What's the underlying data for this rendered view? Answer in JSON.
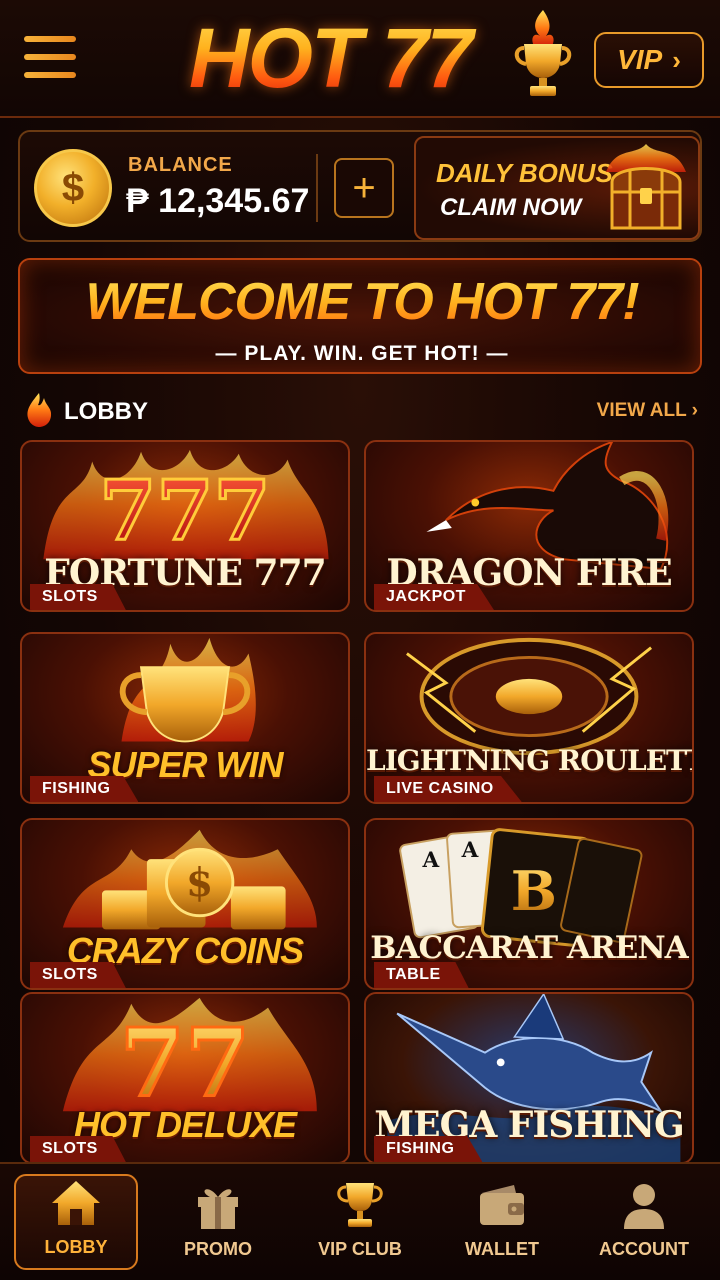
{
  "header": {
    "logo_text": "HOT 77",
    "vip_label": "VIP",
    "vip_chevron": "›"
  },
  "balance": {
    "label": "BALANCE",
    "value": "₱ 12,345.67",
    "coin_symbol": "$",
    "add_symbol": "+"
  },
  "daily_bonus": {
    "line1": "DAILY BONUS",
    "line2": "CLAIM NOW"
  },
  "welcome": {
    "title": "WELCOME TO HOT 77!",
    "subtitle": "— PLAY. WIN. GET HOT! —"
  },
  "lobby": {
    "title": "LOBBY",
    "view_all": "VIEW ALL  ›"
  },
  "games": [
    {
      "name": "FORTUNE 777",
      "category": "SLOTS",
      "art": "777-flames"
    },
    {
      "name": "DRAGON FIRE",
      "category": "JACKPOT",
      "art": "dragon"
    },
    {
      "name": "SUPER WIN",
      "category": "FISHING",
      "art": "trophy"
    },
    {
      "name": "LIGHTNING ROULETTE",
      "category": "LIVE CASINO",
      "art": "roulette"
    },
    {
      "name": "CRAZY COINS",
      "category": "SLOTS",
      "art": "coins"
    },
    {
      "name": "BACCARAT ARENA",
      "category": "TABLE",
      "art": "cards"
    },
    {
      "name": "HOT DELUXE",
      "category": "SLOTS",
      "art": "77-flames"
    },
    {
      "name": "MEGA FISHING",
      "category": "FISHING",
      "art": "marlin"
    }
  ],
  "card_art_text": {
    "sevens_triple": "777",
    "sevens_double": "77",
    "baccarat_letter": "B",
    "card_rank": "A"
  },
  "nav": [
    {
      "label": "LOBBY",
      "icon": "home-icon",
      "active": true
    },
    {
      "label": "PROMO",
      "icon": "gift-icon",
      "active": false
    },
    {
      "label": "VIP CLUB",
      "icon": "trophy-icon",
      "active": false
    },
    {
      "label": "WALLET",
      "icon": "wallet-icon",
      "active": false
    },
    {
      "label": "ACCOUNT",
      "icon": "user-icon",
      "active": false
    }
  ],
  "colors": {
    "accent_gold": "#ffb23a",
    "fire_orange": "#ff6a12",
    "tag_red": "#7a1408",
    "background": "#140604"
  }
}
